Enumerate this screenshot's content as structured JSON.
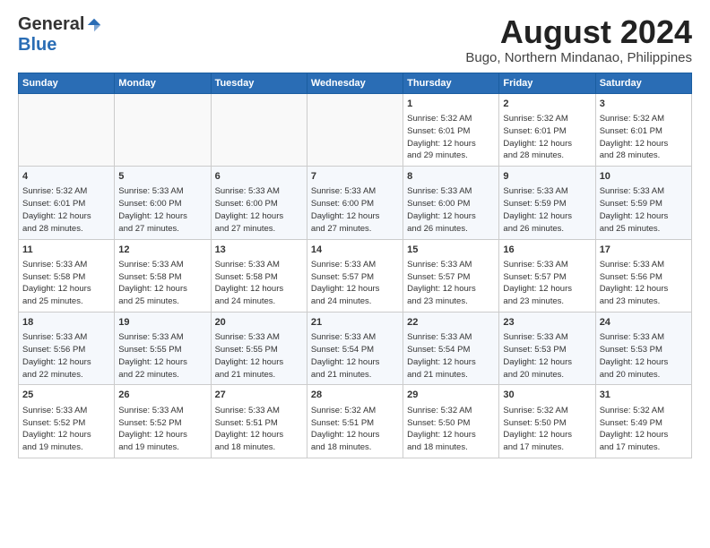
{
  "header": {
    "logo_general": "General",
    "logo_blue": "Blue",
    "title": "August 2024",
    "subtitle": "Bugo, Northern Mindanao, Philippines"
  },
  "weekdays": [
    "Sunday",
    "Monday",
    "Tuesday",
    "Wednesday",
    "Thursday",
    "Friday",
    "Saturday"
  ],
  "weeks": [
    [
      {
        "day": "",
        "info": ""
      },
      {
        "day": "",
        "info": ""
      },
      {
        "day": "",
        "info": ""
      },
      {
        "day": "",
        "info": ""
      },
      {
        "day": "1",
        "info": "Sunrise: 5:32 AM\nSunset: 6:01 PM\nDaylight: 12 hours\nand 29 minutes."
      },
      {
        "day": "2",
        "info": "Sunrise: 5:32 AM\nSunset: 6:01 PM\nDaylight: 12 hours\nand 28 minutes."
      },
      {
        "day": "3",
        "info": "Sunrise: 5:32 AM\nSunset: 6:01 PM\nDaylight: 12 hours\nand 28 minutes."
      }
    ],
    [
      {
        "day": "4",
        "info": "Sunrise: 5:32 AM\nSunset: 6:01 PM\nDaylight: 12 hours\nand 28 minutes."
      },
      {
        "day": "5",
        "info": "Sunrise: 5:33 AM\nSunset: 6:00 PM\nDaylight: 12 hours\nand 27 minutes."
      },
      {
        "day": "6",
        "info": "Sunrise: 5:33 AM\nSunset: 6:00 PM\nDaylight: 12 hours\nand 27 minutes."
      },
      {
        "day": "7",
        "info": "Sunrise: 5:33 AM\nSunset: 6:00 PM\nDaylight: 12 hours\nand 27 minutes."
      },
      {
        "day": "8",
        "info": "Sunrise: 5:33 AM\nSunset: 6:00 PM\nDaylight: 12 hours\nand 26 minutes."
      },
      {
        "day": "9",
        "info": "Sunrise: 5:33 AM\nSunset: 5:59 PM\nDaylight: 12 hours\nand 26 minutes."
      },
      {
        "day": "10",
        "info": "Sunrise: 5:33 AM\nSunset: 5:59 PM\nDaylight: 12 hours\nand 25 minutes."
      }
    ],
    [
      {
        "day": "11",
        "info": "Sunrise: 5:33 AM\nSunset: 5:58 PM\nDaylight: 12 hours\nand 25 minutes."
      },
      {
        "day": "12",
        "info": "Sunrise: 5:33 AM\nSunset: 5:58 PM\nDaylight: 12 hours\nand 25 minutes."
      },
      {
        "day": "13",
        "info": "Sunrise: 5:33 AM\nSunset: 5:58 PM\nDaylight: 12 hours\nand 24 minutes."
      },
      {
        "day": "14",
        "info": "Sunrise: 5:33 AM\nSunset: 5:57 PM\nDaylight: 12 hours\nand 24 minutes."
      },
      {
        "day": "15",
        "info": "Sunrise: 5:33 AM\nSunset: 5:57 PM\nDaylight: 12 hours\nand 23 minutes."
      },
      {
        "day": "16",
        "info": "Sunrise: 5:33 AM\nSunset: 5:57 PM\nDaylight: 12 hours\nand 23 minutes."
      },
      {
        "day": "17",
        "info": "Sunrise: 5:33 AM\nSunset: 5:56 PM\nDaylight: 12 hours\nand 23 minutes."
      }
    ],
    [
      {
        "day": "18",
        "info": "Sunrise: 5:33 AM\nSunset: 5:56 PM\nDaylight: 12 hours\nand 22 minutes."
      },
      {
        "day": "19",
        "info": "Sunrise: 5:33 AM\nSunset: 5:55 PM\nDaylight: 12 hours\nand 22 minutes."
      },
      {
        "day": "20",
        "info": "Sunrise: 5:33 AM\nSunset: 5:55 PM\nDaylight: 12 hours\nand 21 minutes."
      },
      {
        "day": "21",
        "info": "Sunrise: 5:33 AM\nSunset: 5:54 PM\nDaylight: 12 hours\nand 21 minutes."
      },
      {
        "day": "22",
        "info": "Sunrise: 5:33 AM\nSunset: 5:54 PM\nDaylight: 12 hours\nand 21 minutes."
      },
      {
        "day": "23",
        "info": "Sunrise: 5:33 AM\nSunset: 5:53 PM\nDaylight: 12 hours\nand 20 minutes."
      },
      {
        "day": "24",
        "info": "Sunrise: 5:33 AM\nSunset: 5:53 PM\nDaylight: 12 hours\nand 20 minutes."
      }
    ],
    [
      {
        "day": "25",
        "info": "Sunrise: 5:33 AM\nSunset: 5:52 PM\nDaylight: 12 hours\nand 19 minutes."
      },
      {
        "day": "26",
        "info": "Sunrise: 5:33 AM\nSunset: 5:52 PM\nDaylight: 12 hours\nand 19 minutes."
      },
      {
        "day": "27",
        "info": "Sunrise: 5:33 AM\nSunset: 5:51 PM\nDaylight: 12 hours\nand 18 minutes."
      },
      {
        "day": "28",
        "info": "Sunrise: 5:32 AM\nSunset: 5:51 PM\nDaylight: 12 hours\nand 18 minutes."
      },
      {
        "day": "29",
        "info": "Sunrise: 5:32 AM\nSunset: 5:50 PM\nDaylight: 12 hours\nand 18 minutes."
      },
      {
        "day": "30",
        "info": "Sunrise: 5:32 AM\nSunset: 5:50 PM\nDaylight: 12 hours\nand 17 minutes."
      },
      {
        "day": "31",
        "info": "Sunrise: 5:32 AM\nSunset: 5:49 PM\nDaylight: 12 hours\nand 17 minutes."
      }
    ]
  ]
}
